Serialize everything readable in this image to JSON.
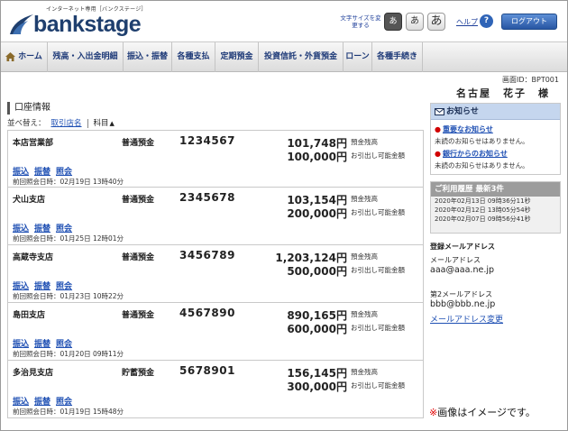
{
  "header": {
    "tagline": "インターネット専用［バンクステージ］",
    "logo_text": "bankstage",
    "font_size_label": "文字サイズを変更する",
    "font_sizes": [
      "あ",
      "あ",
      "あ"
    ],
    "help_label": "ヘルプ",
    "help_icon": "?",
    "logout_label": "ログアウト"
  },
  "nav": {
    "home": "ホーム",
    "balance": "残高・入出金明細",
    "transfer": "振込・振替",
    "payment": "各種支払",
    "deposit": "定期預金",
    "invest": "投資信託・外貨預金",
    "loan": "ローン",
    "procedures": "各種手続き"
  },
  "screen_id": "画面ID：BPT001",
  "user_name": "名古屋　花子　様",
  "accounts_section": {
    "title": "口座情報",
    "sort_label": "並べ替え：",
    "sort_by_branch": "取引店名",
    "sort_by_subject": "科目",
    "sort_arrow": "▲"
  },
  "accounts": [
    {
      "branch": "本店営業部",
      "type": "普通預金",
      "number": "1234567",
      "balance": "101,748円",
      "available": "100,000円",
      "last_inquiry": "前回照会日時：02月19日 13時40分"
    },
    {
      "branch": "犬山支店",
      "type": "普通預金",
      "number": "2345678",
      "balance": "103,154円",
      "available": "200,000円",
      "last_inquiry": "前回照会日時：01月25日 12時01分"
    },
    {
      "branch": "高蔵寺支店",
      "type": "普通預金",
      "number": "3456789",
      "balance": "1,203,124円",
      "available": "500,000円",
      "last_inquiry": "前回照会日時：01月23日 10時22分"
    },
    {
      "branch": "島田支店",
      "type": "普通預金",
      "number": "4567890",
      "balance": "890,165円",
      "available": "600,000円",
      "last_inquiry": "前回照会日時：01月20日 09時11分"
    },
    {
      "branch": "多治見支店",
      "type": "貯蓄預金",
      "number": "5678901",
      "balance": "156,145円",
      "available": "300,000円",
      "last_inquiry": "前回照会日時：01月19日 15時48分"
    }
  ],
  "account_labels": {
    "balance_label": "預金残高",
    "available_label": "お引出し可能金額",
    "link_transfer": "振込",
    "link_move": "振替",
    "link_inquiry": "照会"
  },
  "notice": {
    "title": "お知らせ",
    "important_link": "重要なお知らせ",
    "important_text": "未読のお知らせはありません。",
    "bank_link": "銀行からのお知らせ",
    "bank_text": "未読のお知らせはありません。",
    "bullet": "●"
  },
  "history": {
    "title": "ご利用履歴 最新3件",
    "entries": [
      "2020年02月13日 09時36分11秒",
      "2020年02月12日 13時05分54秒",
      "2020年02月07日 09時56分41秒"
    ]
  },
  "email": {
    "heading": "登録メールアドレス",
    "label1": "メールアドレス",
    "value1": "aaa@aaa.ne.jp",
    "label2": "第2メールアドレス",
    "value2": "bbb@bbb.ne.jp",
    "change_link": "メールアドレス変更"
  },
  "image_note": {
    "mark": "※",
    "text": "画像はイメージです。"
  },
  "colors": {
    "brand": "#1f3f6e",
    "link": "#1e4fb3",
    "notice_header": "#c5d6ee",
    "history_header": "#9c9c9c",
    "logout": "#2856a3"
  }
}
